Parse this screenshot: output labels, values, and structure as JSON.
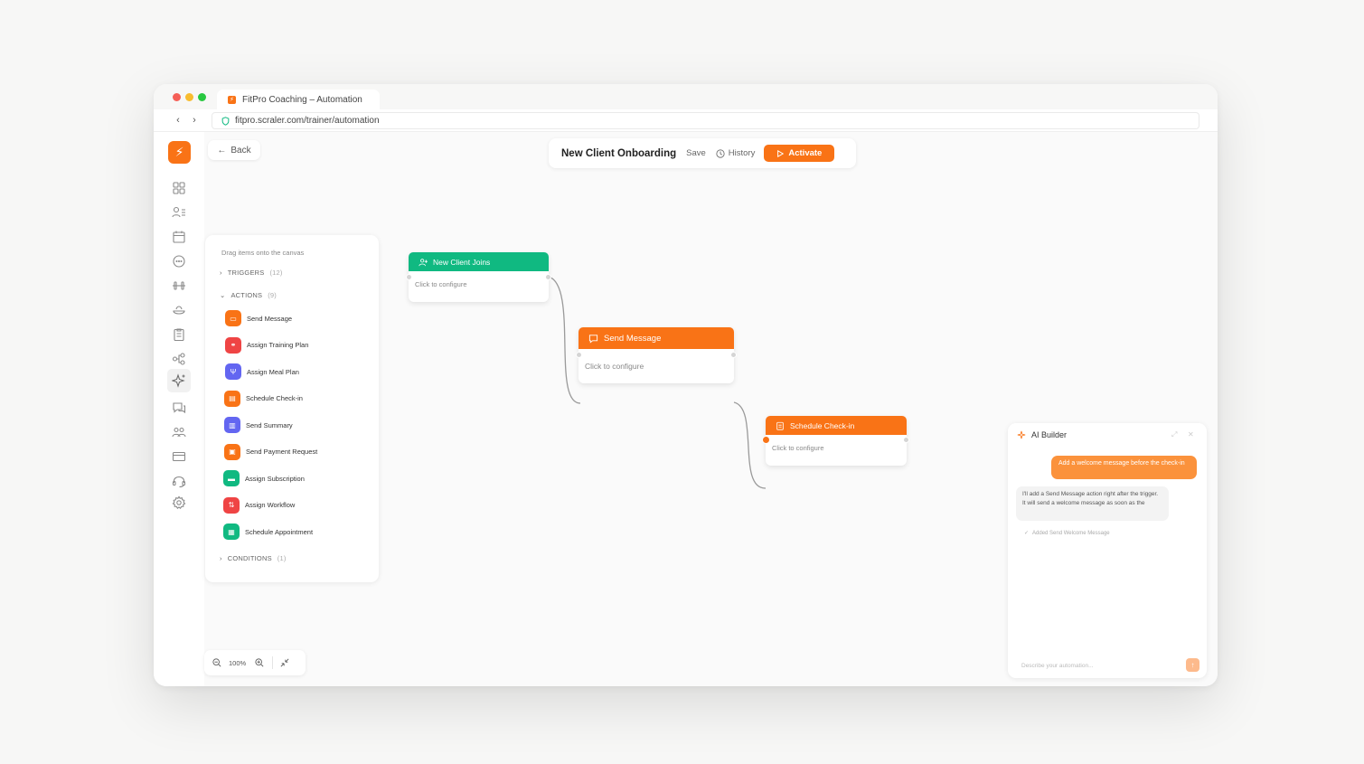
{
  "browser": {
    "tab_title": "FitPro Coaching – Automation",
    "url": "fitpro.scraler.com/trainer/automation"
  },
  "toolbar": {
    "back_label": "Back",
    "workflow_title": "New Client Onboarding",
    "save_label": "Save",
    "history_label": "History",
    "activate_label": "Activate"
  },
  "palette": {
    "hint": "Drag items onto the canvas",
    "triggers": {
      "label": "TRIGGERS",
      "count": "(12)"
    },
    "actions": {
      "label": "ACTIONS",
      "count": "(9)",
      "items": [
        {
          "label": "Send Message",
          "color": "#f97316",
          "icon": "message-icon"
        },
        {
          "label": "Assign Training Plan",
          "color": "#ef4444",
          "icon": "dumbbell-icon"
        },
        {
          "label": "Assign Meal Plan",
          "color": "#6366f1",
          "icon": "utensils-icon"
        },
        {
          "label": "Schedule Check-in",
          "color": "#f97316",
          "icon": "clipboard-icon"
        },
        {
          "label": "Send Summary",
          "color": "#6366f1",
          "icon": "bar-chart-icon"
        },
        {
          "label": "Send Payment Request",
          "color": "#f97316",
          "icon": "payment-icon"
        },
        {
          "label": "Assign Subscription",
          "color": "#10b981",
          "icon": "card-icon"
        },
        {
          "label": "Assign Workflow",
          "color": "#ef4444",
          "icon": "workflow-icon"
        },
        {
          "label": "Schedule Appointment",
          "color": "#10b981",
          "icon": "calendar-icon"
        }
      ]
    },
    "conditions": {
      "label": "CONDITIONS",
      "count": "(1)"
    }
  },
  "nodes": [
    {
      "title": "New Client Joins",
      "body": "Click to configure",
      "color": "#10b981",
      "icon": "user-plus-icon"
    },
    {
      "title": "Send Message",
      "body": "Click to configure",
      "color": "#f97316",
      "icon": "message-icon"
    },
    {
      "title": "Schedule Check-in",
      "body": "Click to configure",
      "color": "#f97316",
      "icon": "clipboard-icon"
    }
  ],
  "zoom": {
    "level": "100%"
  },
  "ai": {
    "title": "AI Builder",
    "user_message": "Add a welcome message before the check-in",
    "bot_message": "I'll add a Send Message action right after the trigger. It will send a welcome message as soon as the",
    "added_note": "Added Send Welcome Message",
    "input_placeholder": "Describe your automation..."
  },
  "colors": {
    "accent": "#f97316",
    "trigger": "#10b981"
  }
}
